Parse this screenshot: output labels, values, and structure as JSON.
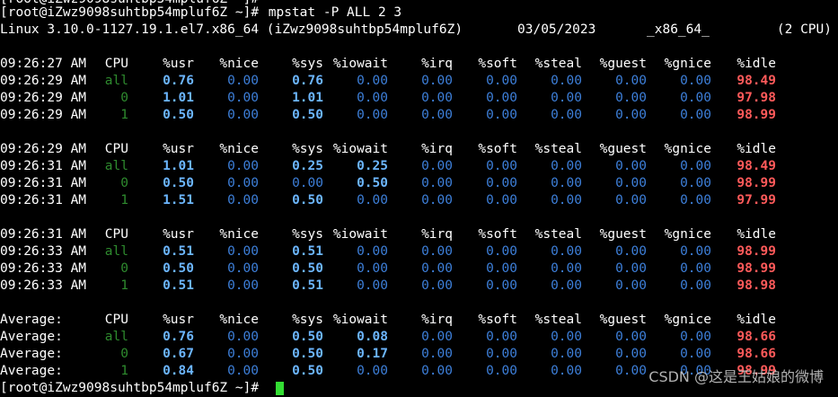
{
  "terminal": {
    "prompt_top": "[root@iZwz9098suhtbp54mpluf6Z ~]#",
    "command": " mpstat -P ALL 2 3",
    "sysinfo": {
      "kernel": "Linux 3.10.0-1127.19.1.el7.x86_64 (iZwz9098suhtbp54mpluf6Z)",
      "date": "03/05/2023",
      "arch": "_x86_64_",
      "cpus": "(2 CPU)"
    },
    "headers": [
      "CPU",
      "%usr",
      "%nice",
      "%sys",
      "%iowait",
      "%irq",
      "%soft",
      "%steal",
      "%guest",
      "%gnice",
      "%idle"
    ],
    "blocks": [
      {
        "header_time": "09:26:27 AM",
        "rows": [
          {
            "time": "09:26:29 AM",
            "cpu": "all",
            "usr": "0.76",
            "nice": "0.00",
            "sys": "0.76",
            "iowait": "0.00",
            "irq": "0.00",
            "soft": "0.00",
            "steal": "0.00",
            "guest": "0.00",
            "gnice": "0.00",
            "idle": "98.49"
          },
          {
            "time": "09:26:29 AM",
            "cpu": "0",
            "usr": "1.01",
            "nice": "0.00",
            "sys": "1.01",
            "iowait": "0.00",
            "irq": "0.00",
            "soft": "0.00",
            "steal": "0.00",
            "guest": "0.00",
            "gnice": "0.00",
            "idle": "97.98"
          },
          {
            "time": "09:26:29 AM",
            "cpu": "1",
            "usr": "0.50",
            "nice": "0.00",
            "sys": "0.50",
            "iowait": "0.00",
            "irq": "0.00",
            "soft": "0.00",
            "steal": "0.00",
            "guest": "0.00",
            "gnice": "0.00",
            "idle": "98.99"
          }
        ]
      },
      {
        "header_time": "09:26:29 AM",
        "rows": [
          {
            "time": "09:26:31 AM",
            "cpu": "all",
            "usr": "1.01",
            "nice": "0.00",
            "sys": "0.25",
            "iowait": "0.25",
            "irq": "0.00",
            "soft": "0.00",
            "steal": "0.00",
            "guest": "0.00",
            "gnice": "0.00",
            "idle": "98.49"
          },
          {
            "time": "09:26:31 AM",
            "cpu": "0",
            "usr": "0.50",
            "nice": "0.00",
            "sys": "0.00",
            "iowait": "0.50",
            "irq": "0.00",
            "soft": "0.00",
            "steal": "0.00",
            "guest": "0.00",
            "gnice": "0.00",
            "idle": "98.99"
          },
          {
            "time": "09:26:31 AM",
            "cpu": "1",
            "usr": "1.51",
            "nice": "0.00",
            "sys": "0.50",
            "iowait": "0.00",
            "irq": "0.00",
            "soft": "0.00",
            "steal": "0.00",
            "guest": "0.00",
            "gnice": "0.00",
            "idle": "97.99"
          }
        ]
      },
      {
        "header_time": "09:26:31 AM",
        "rows": [
          {
            "time": "09:26:33 AM",
            "cpu": "all",
            "usr": "0.51",
            "nice": "0.00",
            "sys": "0.51",
            "iowait": "0.00",
            "irq": "0.00",
            "soft": "0.00",
            "steal": "0.00",
            "guest": "0.00",
            "gnice": "0.00",
            "idle": "98.99"
          },
          {
            "time": "09:26:33 AM",
            "cpu": "0",
            "usr": "0.50",
            "nice": "0.00",
            "sys": "0.50",
            "iowait": "0.00",
            "irq": "0.00",
            "soft": "0.00",
            "steal": "0.00",
            "guest": "0.00",
            "gnice": "0.00",
            "idle": "98.99"
          },
          {
            "time": "09:26:33 AM",
            "cpu": "1",
            "usr": "0.51",
            "nice": "0.00",
            "sys": "0.51",
            "iowait": "0.00",
            "irq": "0.00",
            "soft": "0.00",
            "steal": "0.00",
            "guest": "0.00",
            "gnice": "0.00",
            "idle": "98.98"
          }
        ]
      },
      {
        "header_time": "Average:",
        "rows": [
          {
            "time": "Average:",
            "cpu": "all",
            "usr": "0.76",
            "nice": "0.00",
            "sys": "0.50",
            "iowait": "0.08",
            "irq": "0.00",
            "soft": "0.00",
            "steal": "0.00",
            "guest": "0.00",
            "gnice": "0.00",
            "idle": "98.66"
          },
          {
            "time": "Average:",
            "cpu": "0",
            "usr": "0.67",
            "nice": "0.00",
            "sys": "0.50",
            "iowait": "0.17",
            "irq": "0.00",
            "soft": "0.00",
            "steal": "0.00",
            "guest": "0.00",
            "gnice": "0.00",
            "idle": "98.66"
          },
          {
            "time": "Average:",
            "cpu": "1",
            "usr": "0.84",
            "nice": "0.00",
            "sys": "0.50",
            "iowait": "0.00",
            "irq": "0.00",
            "soft": "0.00",
            "steal": "0.00",
            "guest": "0.00",
            "gnice": "0.00",
            "idle": "98.99"
          }
        ]
      }
    ],
    "prompt_bottom": "[root@iZwz9098suhtbp54mpluf6Z ~]#"
  },
  "watermark": "CSDN @这是王姑娘的微博",
  "colors": {
    "background": "#000000",
    "text": "#ffffff",
    "cpu_label": "#2e8b2e",
    "value_highlight": "#6cb6ff",
    "value_zero": "#3d7fd9",
    "idle": "#ff5a5a",
    "cursor": "#33dd33"
  }
}
